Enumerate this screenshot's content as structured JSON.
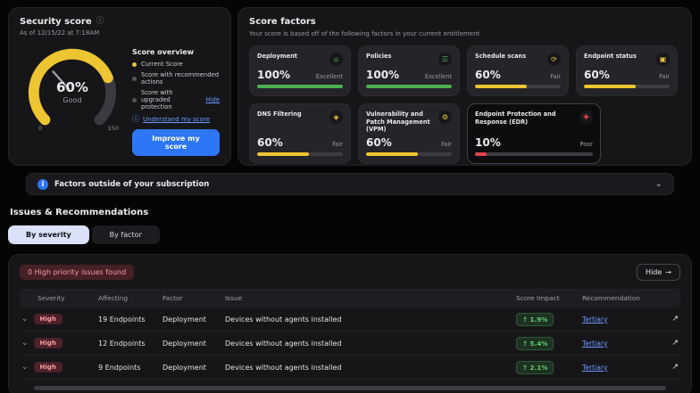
{
  "icons": {
    "info": "ⓘ",
    "understand": "ⓘ",
    "subscription_badge": "i",
    "chevron_down": "⌄",
    "external_link": "↗",
    "arrow_right": "→"
  },
  "security_score": {
    "title": "Security score",
    "as_of": "As of 12/15/22 at 7:18AM",
    "gauge": {
      "value": "60%",
      "label": "Good",
      "min": "0",
      "max": "150",
      "fill_fraction": 0.75,
      "fill_color": "#edc531"
    },
    "overview": {
      "title": "Score overview",
      "items": [
        {
          "label": "Current Score",
          "dot_color": "#edc531"
        },
        {
          "label": "Score with recommended actions",
          "dot_color": "#55555a"
        },
        {
          "label": "Score with upgraded protection",
          "dot_color": "#55555a",
          "suffix_link": "Hide"
        }
      ],
      "understand_link": "Understand my score"
    },
    "improve_button": "Improve my score"
  },
  "score_factors": {
    "title": "Score factors",
    "subtitle": "Your score is based off of the following factors in your current entitlement",
    "cards": [
      {
        "name": "Deployment",
        "value": "100%",
        "status": "Excellent",
        "color": "#4caf50",
        "icon": "deployment-home-icon",
        "glyph": "⌂",
        "fill": 100,
        "highlight": false
      },
      {
        "name": "Policies",
        "value": "100%",
        "status": "Excellent",
        "color": "#4caf50",
        "icon": "policies-list-icon",
        "glyph": "☰",
        "fill": 100,
        "highlight": false
      },
      {
        "name": "Schedule scans",
        "value": "60%",
        "status": "Fair",
        "color": "#edc531",
        "icon": "schedule-scans-icon",
        "glyph": "⟳",
        "fill": 60,
        "highlight": false
      },
      {
        "name": "Endpoint status",
        "value": "60%",
        "status": "Fair",
        "color": "#edc531",
        "icon": "endpoint-status-monitor-icon",
        "glyph": "▣",
        "fill": 60,
        "highlight": false
      },
      {
        "name": "DNS Filtering",
        "value": "60%",
        "status": "Fair",
        "color": "#edc531",
        "icon": "dns-filtering-icon",
        "glyph": "◈",
        "fill": 60,
        "highlight": false
      },
      {
        "name": "Vulnerability and Patch Management (VPM)",
        "value": "60%",
        "status": "Fair",
        "color": "#edc531",
        "icon": "vpm-gear-icon",
        "glyph": "⚙",
        "fill": 60,
        "highlight": false
      },
      {
        "name": "Endpoint Protection and Response (EDR)",
        "value": "10%",
        "status": "Poor",
        "color": "#e8434a",
        "icon": "edr-shield-icon",
        "glyph": "✚",
        "fill": 10,
        "highlight": true
      }
    ]
  },
  "outside_factors": {
    "label": "Factors outside of your subscription"
  },
  "issues": {
    "section_title": "Issues & Recommendations",
    "tabs": [
      {
        "label": "By severity",
        "active": true
      },
      {
        "label": "By factor",
        "active": false
      }
    ],
    "priority_badge": "0 High priority issues found",
    "hide_button": "Hide",
    "table": {
      "headers": [
        "Severity",
        "Affecting",
        "Factor",
        "Issue",
        "Score Impact",
        "Recommendation"
      ],
      "rows": [
        {
          "severity": "High",
          "affecting": "19 Endpoints",
          "factor": "Deployment",
          "issue": "Devices without agents installed",
          "score_impact": "↑ 1.9%",
          "recommendation": "Tertiary"
        },
        {
          "severity": "High",
          "affecting": "12 Endpoints",
          "factor": "Deployment",
          "issue": "Devices without agents installed",
          "score_impact": "↑ 5.4%",
          "recommendation": "Tertiary"
        },
        {
          "severity": "High",
          "affecting": "9 Endpoints",
          "factor": "Deployment",
          "issue": "Devices without agents installed",
          "score_impact": "↑ 2.1%",
          "recommendation": "Tertiary"
        }
      ]
    }
  }
}
